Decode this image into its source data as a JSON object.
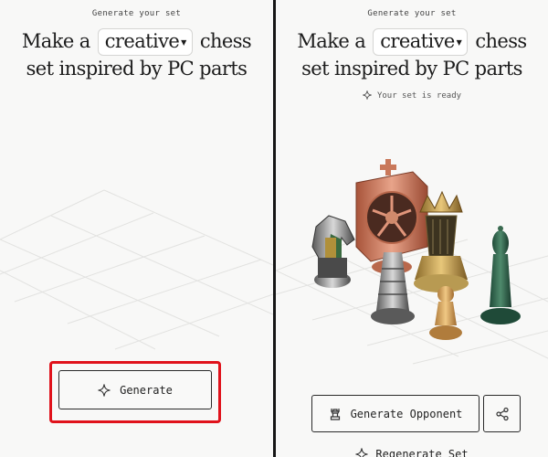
{
  "left_panel": {
    "eyebrow": "Generate your set",
    "headline_before": "Make a",
    "mode_value": "creative",
    "headline_after_line1": "chess",
    "headline_line2": "set inspired by PC parts",
    "generate_label": "Generate"
  },
  "right_panel": {
    "eyebrow": "Generate your set",
    "headline_before": "Make a",
    "mode_value": "creative",
    "headline_after_line1": "chess",
    "headline_line2": "set inspired by PC parts",
    "status_text": "Your set is ready",
    "opponent_label": "Generate Opponent",
    "regenerate_label": "Regenerate Set"
  },
  "icons": {
    "sparkle": "sparkle-icon",
    "caret": "chevron-down-icon",
    "rook": "rook-icon",
    "share": "share-icon"
  },
  "colors": {
    "highlight": "#e0121b",
    "background": "#f8f8f7",
    "divider": "#161616"
  }
}
